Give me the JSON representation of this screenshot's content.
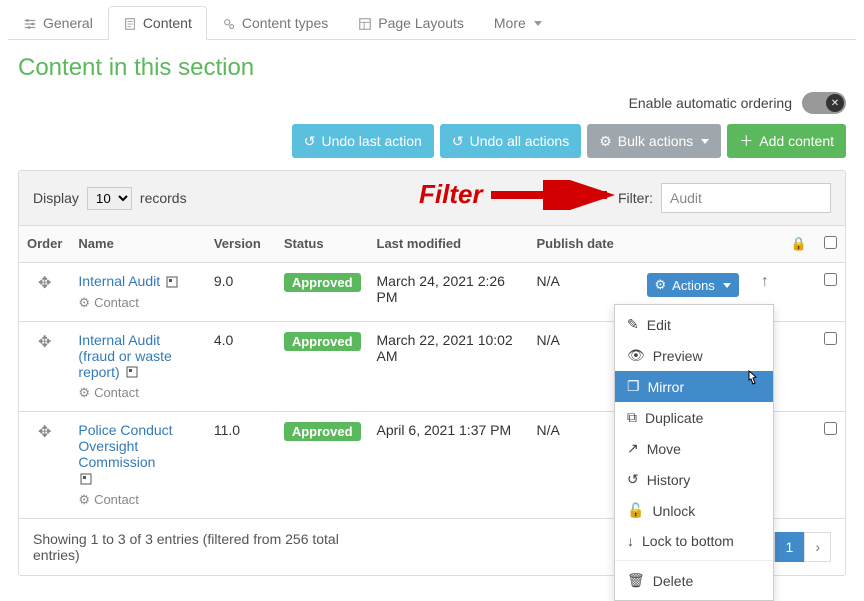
{
  "tabs": {
    "general": "General",
    "content": "Content",
    "content_types": "Content types",
    "page_layouts": "Page Layouts",
    "more": "More"
  },
  "page_title": "Content in this section",
  "auto_order_label": "Enable automatic ordering",
  "buttons": {
    "undo_last": "Undo last action",
    "undo_all": "Undo all actions",
    "bulk": "Bulk actions",
    "add": "Add content",
    "actions": "Actions"
  },
  "display": {
    "label_left": "Display",
    "value": "10",
    "label_right": "records"
  },
  "filter": {
    "label": "Filter:",
    "value": "Audit"
  },
  "callout": "Filter",
  "columns": {
    "order": "Order",
    "name": "Name",
    "version": "Version",
    "status": "Status",
    "last_modified": "Last modified",
    "publish_date": "Publish date"
  },
  "status_label": "Approved",
  "type_label": "Contact",
  "rows": [
    {
      "name": "Internal Audit",
      "version": "9.0",
      "last_modified": "March 24, 2021 2:26 PM",
      "publish": "N/A"
    },
    {
      "name": "Internal Audit (fraud or waste report)",
      "version": "4.0",
      "last_modified": "March 22, 2021 10:02 AM",
      "publish": "N/A"
    },
    {
      "name": "Police Conduct Oversight Commission",
      "version": "11.0",
      "last_modified": "April 6, 2021 1:37 PM",
      "publish": "N/A"
    }
  ],
  "dropdown": {
    "edit": "Edit",
    "preview": "Preview",
    "mirror": "Mirror",
    "duplicate": "Duplicate",
    "move": "Move",
    "history": "History",
    "unlock": "Unlock",
    "lock_bottom": "Lock to bottom",
    "delete": "Delete"
  },
  "footer": "Showing 1 to 3 of 3 entries (filtered from 256 total entries)",
  "pager": {
    "page": "1"
  }
}
